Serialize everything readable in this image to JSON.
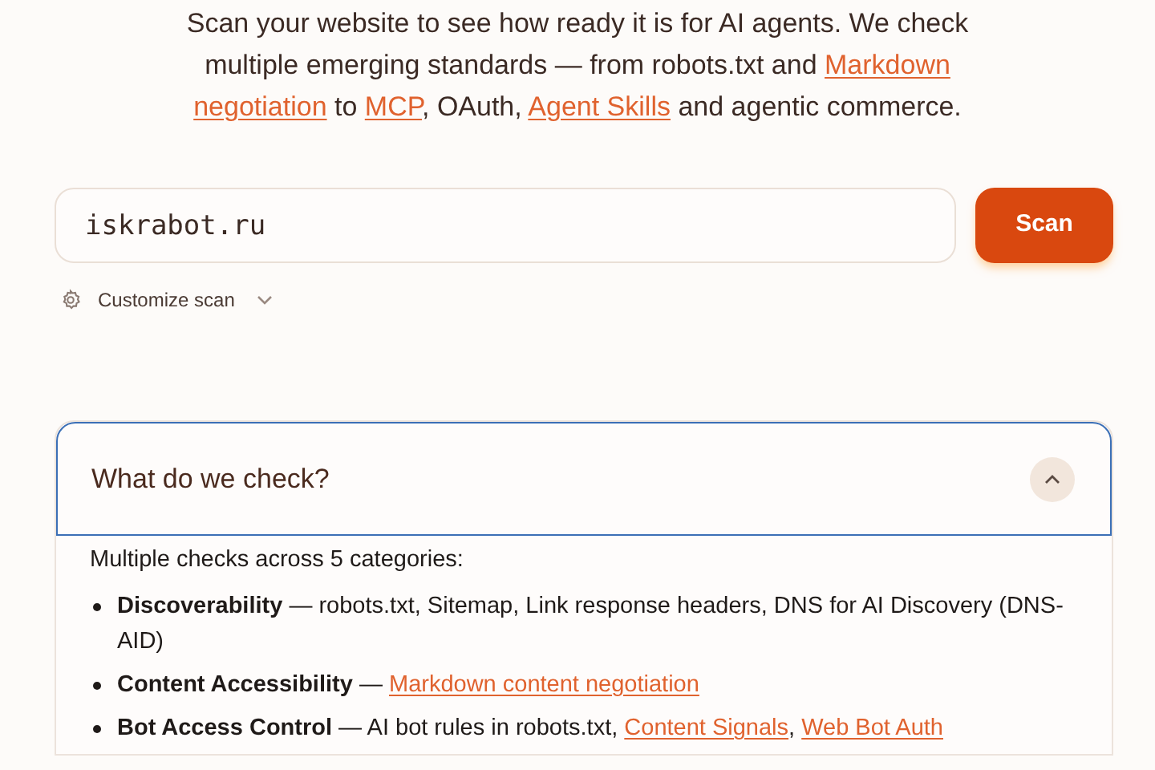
{
  "intro": [
    {
      "text": "Scan your website to see how ready it is for AI agents. We check multiple emerging standards — from robots.txt and ",
      "link": false
    },
    {
      "text": "Markdown",
      "link": true
    },
    {
      "text": "negotiation",
      "link": true
    },
    {
      "text": " to ",
      "link": false
    },
    {
      "text": "MCP",
      "link": true
    },
    {
      "text": ", OAuth, ",
      "link": false
    },
    {
      "text": "Agent Skills",
      "link": true
    },
    {
      "text": " and agentic commerce.",
      "link": false
    }
  ],
  "scan": {
    "value": "iskrabot.ru",
    "button": "Scan"
  },
  "customize": {
    "label": "Customize scan",
    "expanded": false
  },
  "faq": {
    "question": "What do we check?",
    "expanded": true,
    "lead": "Multiple checks across 5 categories:",
    "items": [
      {
        "title": "Discoverability",
        "parts": [
          {
            "text": " — robots.txt, Sitemap, Link response headers, DNS for AI Discovery (DNS-AID)",
            "link": false
          }
        ]
      },
      {
        "title": "Content Accessibility",
        "parts": [
          {
            "text": " — ",
            "link": false
          },
          {
            "text": "Markdown content negotiation",
            "link": true
          }
        ]
      },
      {
        "title": "Bot Access Control",
        "parts": [
          {
            "text": " — AI bot rules in robots.txt, ",
            "link": false
          },
          {
            "text": "Content Signals",
            "link": true,
            "after": ", "
          },
          {
            "text": "Web Bot Auth",
            "link": true
          }
        ]
      }
    ]
  }
}
